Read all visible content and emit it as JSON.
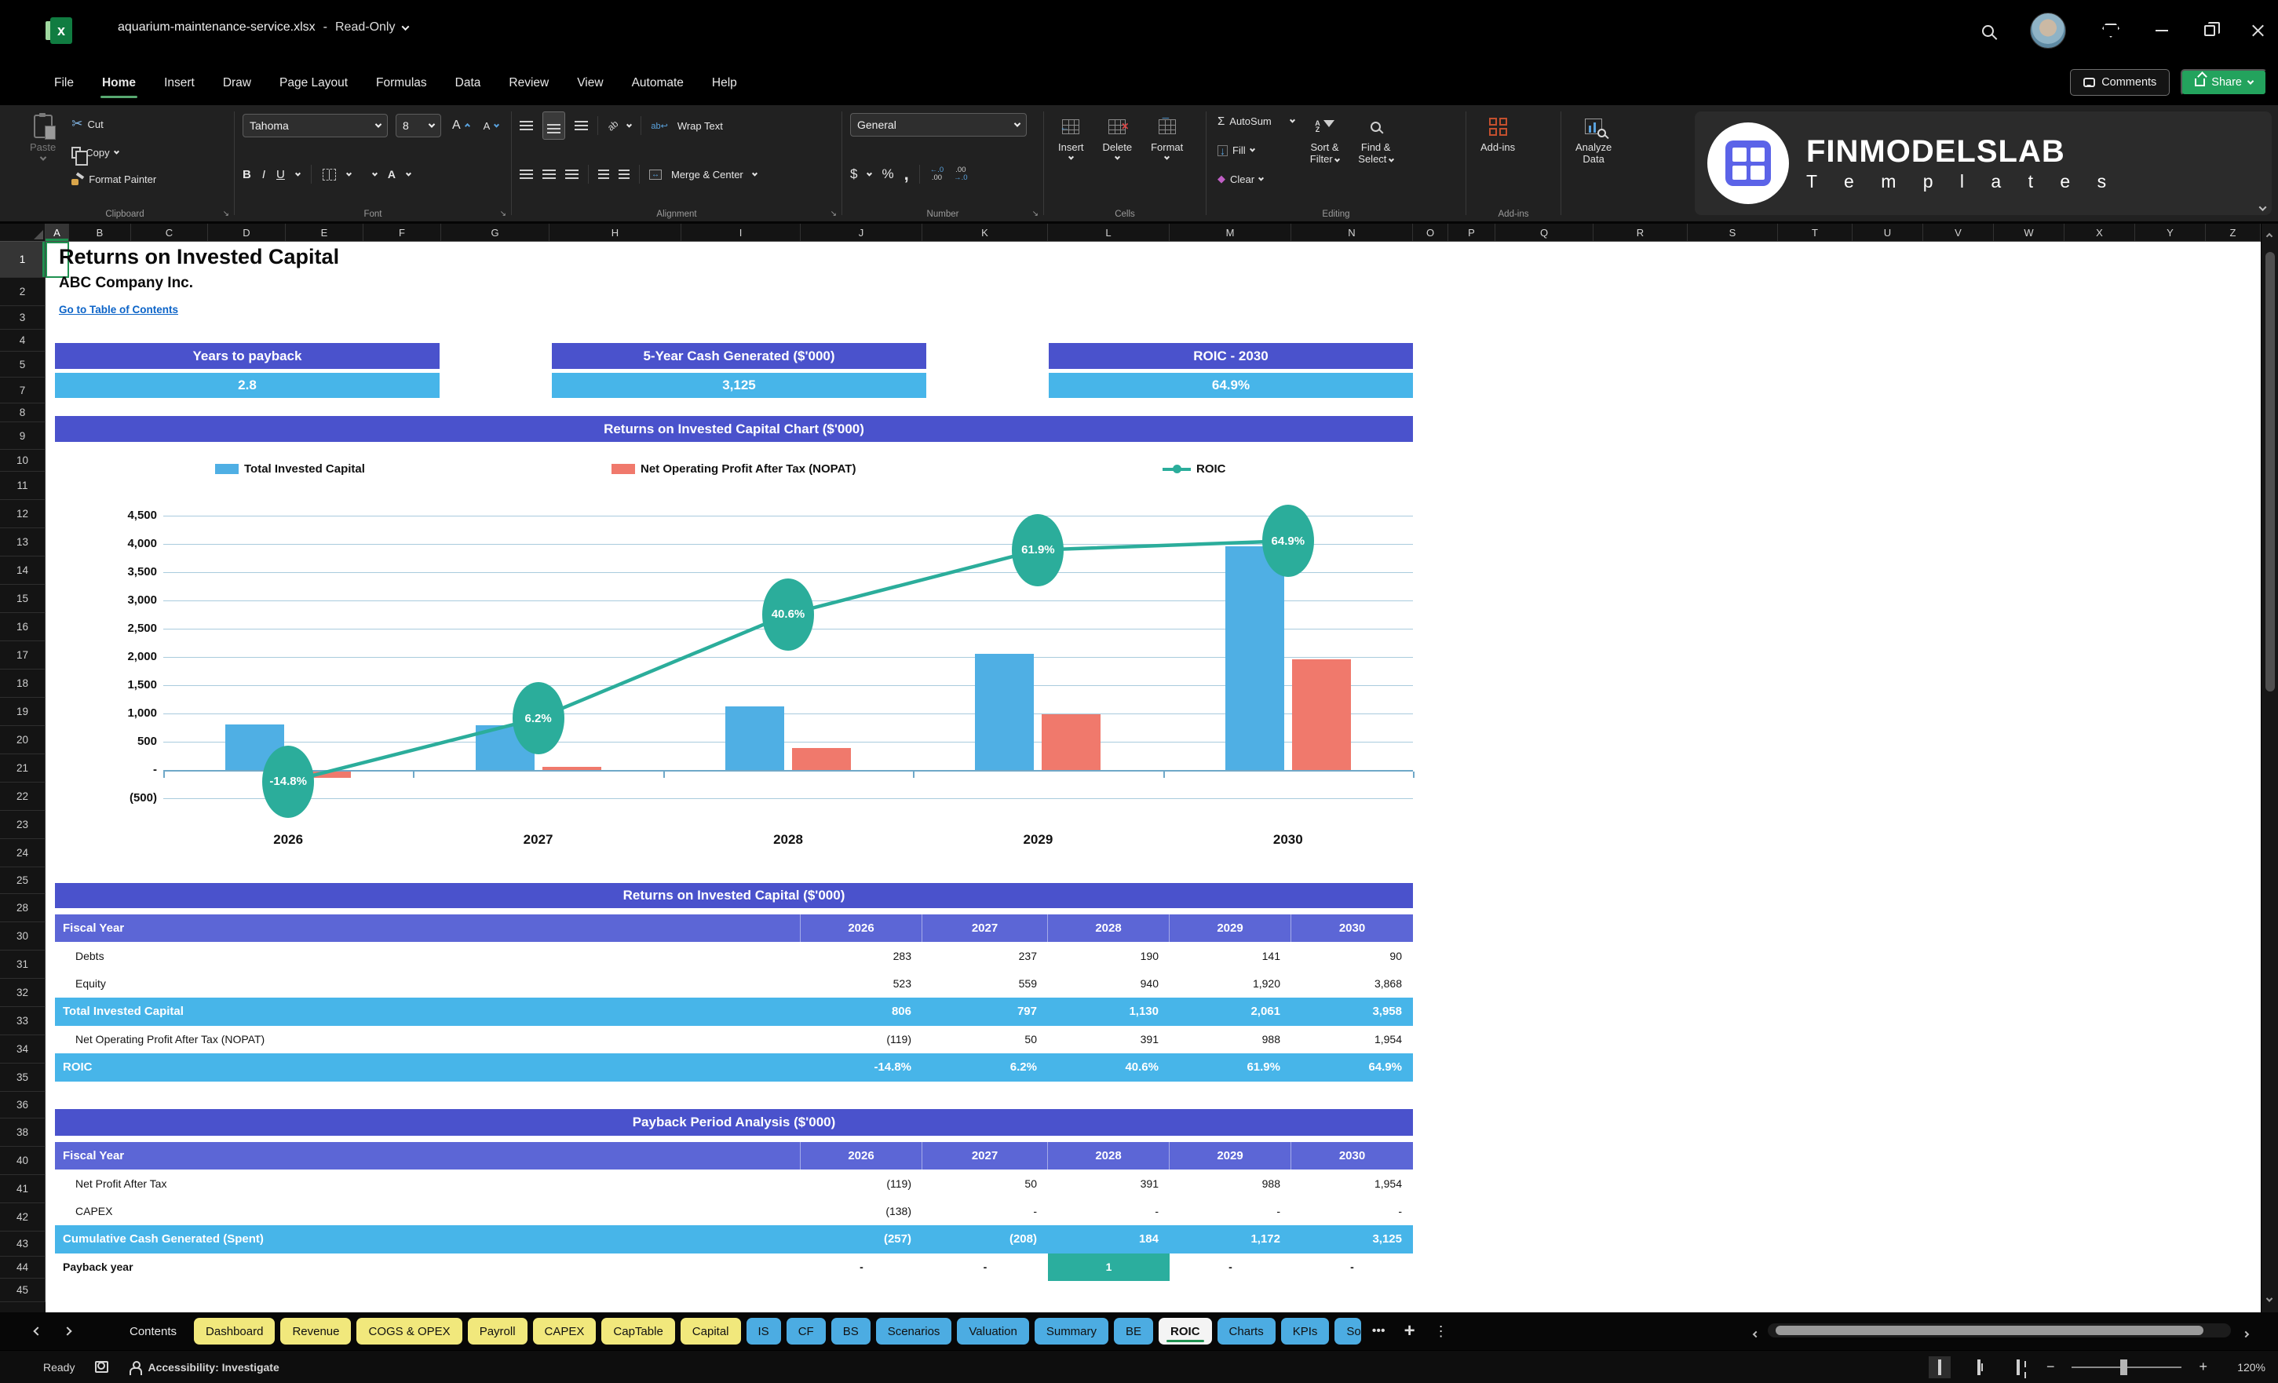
{
  "titlebar": {
    "filename": "aquarium-maintenance-service.xlsx",
    "separator": "-",
    "mode": "Read-Only"
  },
  "menu": {
    "items": [
      "File",
      "Home",
      "Insert",
      "Draw",
      "Page Layout",
      "Formulas",
      "Data",
      "Review",
      "View",
      "Automate",
      "Help"
    ],
    "active": "Home",
    "comments": "Comments",
    "share": "Share"
  },
  "ribbon": {
    "paste": "Paste",
    "cut": "Cut",
    "copy": "Copy",
    "format_painter": "Format Painter",
    "clipboard_label": "Clipboard",
    "font_name": "Tahoma",
    "font_size": "8",
    "font_label": "Font",
    "wrap_text": "Wrap Text",
    "merge_center": "Merge & Center",
    "alignment_label": "Alignment",
    "number_format": "General",
    "number_label": "Number",
    "insert": "Insert",
    "delete": "Delete",
    "format": "Format",
    "cells_label": "Cells",
    "autosum": "AutoSum",
    "fill": "Fill",
    "clear": "Clear",
    "sort_filter_1": "Sort &",
    "sort_filter_2": "Filter",
    "find_select_1": "Find &",
    "find_select_2": "Select",
    "editing_label": "Editing",
    "addins": "Add-ins",
    "addins_label": "Add-ins",
    "analyze_1": "Analyze",
    "analyze_2": "Data",
    "glyphs": {
      "bold": "B",
      "italic": "I",
      "underline": "U",
      "autosum": "Σ",
      "cut": "✂",
      "dollar": "$",
      "percent": "%",
      "comma": ",",
      "sort_a": "A",
      "sort_z": "Z",
      "wrap_ab": "ab↩",
      "orient": "ab",
      "fontA": "A",
      "clear_diamond": "◆",
      "fill_arrow": "↓",
      "dec_l1": "←.0",
      "dec_l2": ".00",
      "dec_r1": ".00",
      "dec_r2": "→.0",
      "merge_arrows": "↔",
      "launcher": "↘"
    },
    "logo_line1": "FINMODELSLAB",
    "logo_line2": "T e m p l a t e s"
  },
  "grid": {
    "columns": [
      "A",
      "B",
      "C",
      "D",
      "E",
      "F",
      "G",
      "H",
      "I",
      "J",
      "K",
      "L",
      "M",
      "N",
      "O",
      "P",
      "Q",
      "R",
      "S",
      "T",
      "U",
      "V",
      "W",
      "X",
      "Y",
      "Z"
    ],
    "rows": [
      "1",
      "2",
      "3",
      "4",
      "5",
      "7",
      "8",
      "9",
      "10",
      "11",
      "12",
      "13",
      "14",
      "15",
      "16",
      "17",
      "18",
      "19",
      "20",
      "21",
      "22",
      "23",
      "24",
      "25",
      "28",
      "30",
      "31",
      "32",
      "33",
      "34",
      "35",
      "36",
      "38",
      "40",
      "41",
      "42",
      "43",
      "44",
      "45"
    ],
    "selected_column": "A",
    "selected_row": "1"
  },
  "sheet": {
    "title": "Returns on Invested Capital",
    "subtitle": "ABC Company Inc.",
    "link": "Go to Table of Contents",
    "kpis": [
      {
        "label": "Years to payback",
        "value": "2.8"
      },
      {
        "label": "5-Year Cash Generated ($'000)",
        "value": "3,125"
      },
      {
        "label": "ROIC - 2030",
        "value": "64.9%"
      }
    ]
  },
  "chart_data": {
    "type": "combo",
    "title": "Returns on Invested Capital Chart ($'000)",
    "categories": [
      "2026",
      "2027",
      "2028",
      "2029",
      "2030"
    ],
    "series": [
      {
        "name": "Total Invested Capital",
        "type": "bar",
        "color": "#4FAFE4",
        "values": [
          806,
          797,
          1130,
          2061,
          3958
        ]
      },
      {
        "name": "Net Operating Profit After Tax (NOPAT)",
        "type": "bar",
        "color": "#F0796C",
        "values": [
          -119,
          50,
          391,
          988,
          1954
        ]
      },
      {
        "name": "ROIC",
        "type": "line",
        "color": "#2BAD9B",
        "values_pct": [
          -14.8,
          6.2,
          40.6,
          61.9,
          64.9
        ],
        "labels": [
          "-14.8%",
          "6.2%",
          "40.6%",
          "61.9%",
          "64.9%"
        ]
      }
    ],
    "y_axis": {
      "ticks": [
        "4,500",
        "4,000",
        "3,500",
        "3,000",
        "2,500",
        "2,000",
        "1,500",
        "1,000",
        "500",
        "-",
        "(500)"
      ],
      "max": 4500,
      "min": -500,
      "step": 500
    },
    "grid": true,
    "legend_position": "top"
  },
  "tables": {
    "roic": {
      "title": "Returns on Invested Capital ($'000)",
      "header": [
        "Fiscal Year",
        "2026",
        "2027",
        "2028",
        "2029",
        "2030"
      ],
      "rows": [
        {
          "label": "Debts",
          "values": [
            "283",
            "237",
            "190",
            "141",
            "90"
          ],
          "style": "plain"
        },
        {
          "label": "Equity",
          "values": [
            "523",
            "559",
            "940",
            "1,920",
            "3,868"
          ],
          "style": "plain"
        },
        {
          "label": "Total Invested Capital",
          "values": [
            "806",
            "797",
            "1,130",
            "2,061",
            "3,958"
          ],
          "style": "highlight"
        },
        {
          "label": "Net Operating Profit After Tax (NOPAT)",
          "values": [
            "(119)",
            "50",
            "391",
            "988",
            "1,954"
          ],
          "style": "plain"
        },
        {
          "label": "ROIC",
          "values": [
            "-14.8%",
            "6.2%",
            "40.6%",
            "61.9%",
            "64.9%"
          ],
          "style": "highlight"
        }
      ]
    },
    "payback": {
      "title": "Payback Period Analysis ($'000)",
      "header": [
        "Fiscal Year",
        "2026",
        "2027",
        "2028",
        "2029",
        "2030"
      ],
      "rows": [
        {
          "label": "Net Profit After Tax",
          "values": [
            "(119)",
            "50",
            "391",
            "988",
            "1,954"
          ],
          "style": "plain"
        },
        {
          "label": "CAPEX",
          "values": [
            "(138)",
            "-",
            "-",
            "-",
            "-"
          ],
          "style": "plain"
        },
        {
          "label": "Cumulative Cash Generated (Spent)",
          "values": [
            "(257)",
            "(208)",
            "184",
            "1,172",
            "3,125"
          ],
          "style": "highlight"
        },
        {
          "label": "Payback year",
          "values": [
            "-",
            "-",
            "1",
            "-",
            "-"
          ],
          "style": "payback",
          "highlight_cell": 2
        }
      ]
    }
  },
  "tabbar": {
    "tabs": [
      {
        "label": "Contents",
        "kind": "plain"
      },
      {
        "label": "Dashboard",
        "kind": "yellow"
      },
      {
        "label": "Revenue",
        "kind": "yellow"
      },
      {
        "label": "COGS & OPEX",
        "kind": "yellow"
      },
      {
        "label": "Payroll",
        "kind": "yellow"
      },
      {
        "label": "CAPEX",
        "kind": "yellow"
      },
      {
        "label": "CapTable",
        "kind": "yellow"
      },
      {
        "label": "Capital",
        "kind": "yellow"
      },
      {
        "label": "IS",
        "kind": "blue"
      },
      {
        "label": "CF",
        "kind": "blue"
      },
      {
        "label": "BS",
        "kind": "blue"
      },
      {
        "label": "Scenarios",
        "kind": "blue"
      },
      {
        "label": "Valuation",
        "kind": "blue"
      },
      {
        "label": "Summary",
        "kind": "blue"
      },
      {
        "label": "BE",
        "kind": "blue"
      },
      {
        "label": "ROIC",
        "kind": "active"
      },
      {
        "label": "Charts",
        "kind": "blue"
      },
      {
        "label": "KPIs",
        "kind": "blue"
      },
      {
        "label": "So",
        "kind": "blue",
        "clipped": true
      }
    ],
    "more": "•••",
    "add": "+",
    "menu": "⋮"
  },
  "statusbar": {
    "ready": "Ready",
    "accessibility": "Accessibility: Investigate",
    "zoom_level": "120%"
  },
  "colors": {
    "accent_purple": "#4A52CC",
    "header_purple": "#5C66D6",
    "value_blue": "#47B5E9",
    "payback_teal": "#2BAE9E",
    "tab_yellow": "#F1E87C",
    "tab_blue": "#4CACE2",
    "active_green": "#1F9150",
    "link_blue": "#0C64C8",
    "share_green": "#23A35D",
    "excel_green": "#107C41"
  }
}
